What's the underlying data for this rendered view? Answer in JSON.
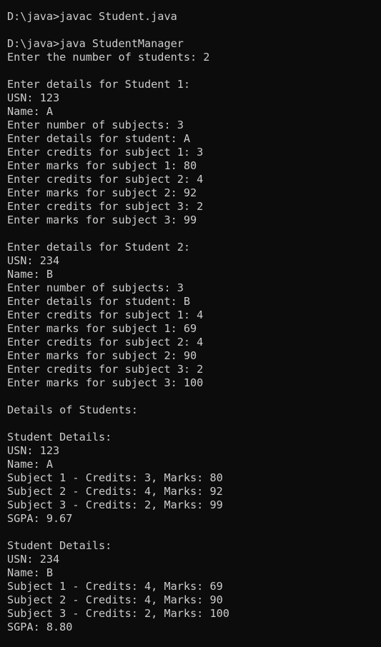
{
  "terminal": {
    "lines": [
      "D:\\java>javac Student.java",
      "",
      "D:\\java>java StudentManager",
      "Enter the number of students: 2",
      "",
      "Enter details for Student 1:",
      "USN: 123",
      "Name: A",
      "Enter number of subjects: 3",
      "Enter details for student: A",
      "Enter credits for subject 1: 3",
      "Enter marks for subject 1: 80",
      "Enter credits for subject 2: 4",
      "Enter marks for subject 2: 92",
      "Enter credits for subject 3: 2",
      "Enter marks for subject 3: 99",
      "",
      "Enter details for Student 2:",
      "USN: 234",
      "Name: B",
      "Enter number of subjects: 3",
      "Enter details for student: B",
      "Enter credits for subject 1: 4",
      "Enter marks for subject 1: 69",
      "Enter credits for subject 2: 4",
      "Enter marks for subject 2: 90",
      "Enter credits for subject 3: 2",
      "Enter marks for subject 3: 100",
      "",
      "Details of Students:",
      "",
      "Student Details:",
      "USN: 123",
      "Name: A",
      "Subject 1 - Credits: 3, Marks: 80",
      "Subject 2 - Credits: 4, Marks: 92",
      "Subject 3 - Credits: 2, Marks: 99",
      "SGPA: 9.67",
      "",
      "Student Details:",
      "USN: 234",
      "Name: B",
      "Subject 1 - Credits: 4, Marks: 69",
      "Subject 2 - Credits: 4, Marks: 90",
      "Subject 3 - Credits: 2, Marks: 100",
      "SGPA: 8.80"
    ]
  },
  "colors": {
    "background": "#0c0c0c",
    "foreground": "#cccccc"
  }
}
